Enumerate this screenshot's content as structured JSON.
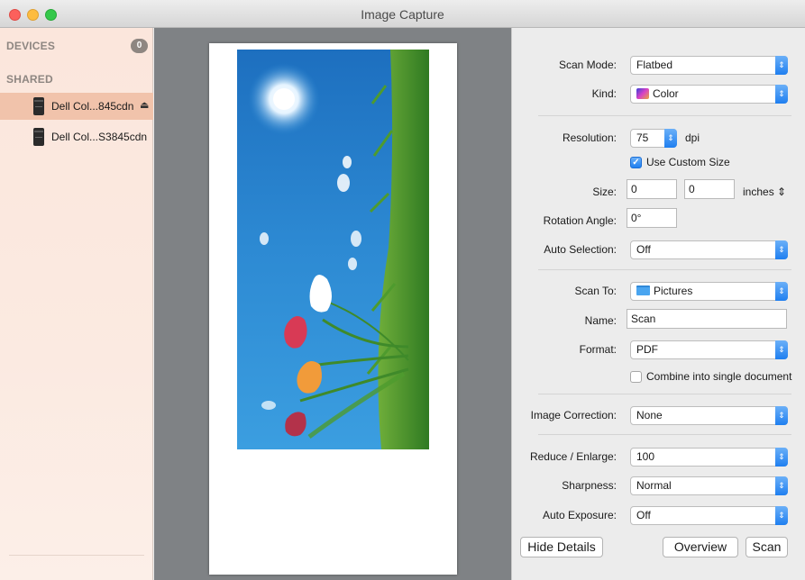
{
  "window": {
    "title": "Image Capture"
  },
  "sidebar": {
    "devices_header": "DEVICES",
    "devices_count": "0",
    "shared_header": "SHARED",
    "devices": [
      {
        "label": "Dell Col...845cdn",
        "selected": true,
        "eject": "⏏"
      },
      {
        "label": "Dell Col...S3845cdn",
        "selected": false
      }
    ]
  },
  "details": {
    "scan_mode": {
      "label": "Scan Mode:",
      "value": "Flatbed"
    },
    "kind": {
      "label": "Kind:",
      "value": "Color"
    },
    "resolution": {
      "label": "Resolution:",
      "value": "75",
      "unit": "dpi"
    },
    "custom_size": {
      "label": "Use Custom Size",
      "checked": true
    },
    "size": {
      "label": "Size:",
      "width": "0",
      "height": "0",
      "unit": "inches"
    },
    "rotation": {
      "label": "Rotation Angle:",
      "value": "0°"
    },
    "auto_selection": {
      "label": "Auto Selection:",
      "value": "Off"
    },
    "scan_to": {
      "label": "Scan To:",
      "value": "Pictures"
    },
    "name": {
      "label": "Name:",
      "value": "Scan"
    },
    "format": {
      "label": "Format:",
      "value": "PDF"
    },
    "combine": {
      "label": "Combine into single document",
      "checked": false
    },
    "image_correction": {
      "label": "Image Correction:",
      "value": "None"
    },
    "reduce_enlarge": {
      "label": "Reduce / Enlarge:",
      "value": "100"
    },
    "sharpness": {
      "label": "Sharpness:",
      "value": "Normal"
    },
    "auto_exposure": {
      "label": "Auto Exposure:",
      "value": "Off"
    }
  },
  "buttons": {
    "hide_details": "Hide Details",
    "overview": "Overview",
    "scan": "Scan"
  },
  "colors": {
    "accent": "#1f7ff0",
    "sidebar_selected": "#f1c3ab",
    "preview_bg": "#7f8285"
  }
}
